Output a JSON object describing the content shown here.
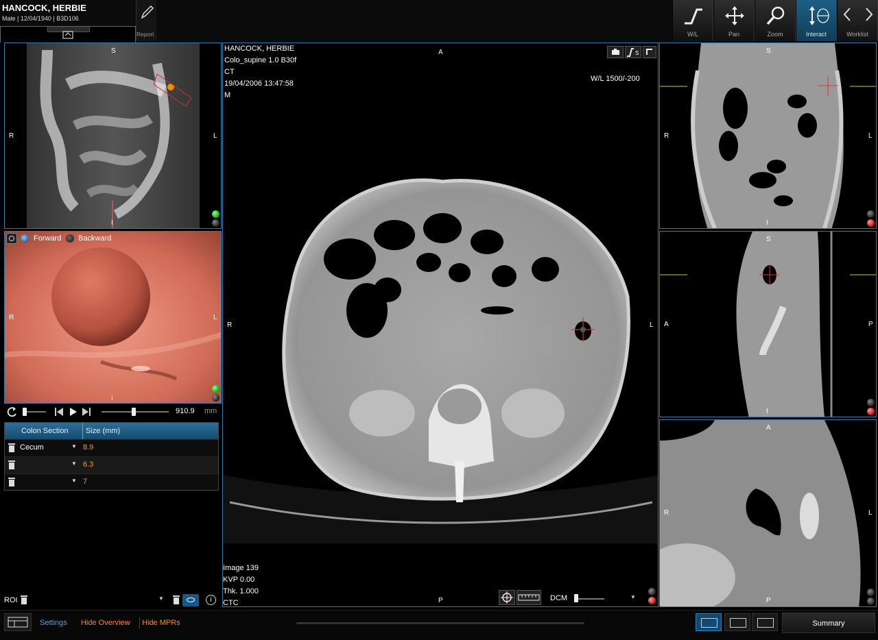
{
  "patient": {
    "name": "HANCOCK, HERBIE",
    "info": "Male | 12/04/1940 | B3D106"
  },
  "toolbar": {
    "report_label": "Report",
    "tools": [
      {
        "label": "W/L",
        "icon": "window-level-icon"
      },
      {
        "label": "Pan",
        "icon": "pan-icon"
      },
      {
        "label": "Zoom",
        "icon": "zoom-icon"
      },
      {
        "label": "Interact",
        "icon": "interact-icon",
        "active": true
      }
    ],
    "worklist_label": "Worklist"
  },
  "overview": {
    "orient_top": "S",
    "orient_left": "R",
    "orient_right": "L",
    "orient_bottom": "I"
  },
  "endo": {
    "forward_label": "Forward",
    "backward_label": "Backward",
    "orient_left": "R",
    "orient_right": "L",
    "orient_bottom": "I",
    "distance": "910.9",
    "unit": "mm"
  },
  "table": {
    "headers": [
      "Colon Section",
      "Size (mm)"
    ],
    "rows": [
      {
        "section": "Cecum",
        "size": "8.9"
      },
      {
        "section": "",
        "size": "6.3"
      },
      {
        "section": "",
        "size": "7"
      }
    ]
  },
  "roi_label": "ROI",
  "axial": {
    "overlay_tl": [
      "HANCOCK, HERBIE",
      "Colo_supine  1.0  B30f",
      "CT",
      "19/04/2006 13:47:58",
      "M"
    ],
    "wl": "W/L  1500/-200",
    "overlay_bl": [
      "Image 139",
      "KVP 0.00",
      "Thk. 1.000",
      "CTC"
    ],
    "orient_top": "A",
    "orient_bottom": "P",
    "orient_left": "R",
    "orient_right": "L",
    "dcm_label": "DCM",
    "snapshot_corner": "S"
  },
  "coronal": {
    "orient_top": "S",
    "orient_left": "R",
    "orient_right": "L",
    "orient_bottom": "I"
  },
  "sagittal": {
    "orient_top": "S",
    "orient_left": "A",
    "orient_right": "P",
    "orient_bottom": "I"
  },
  "zoomview": {
    "orient_top": "A",
    "orient_left": "R",
    "orient_right": "L",
    "orient_bottom": "P"
  },
  "footer": {
    "settings": "Settings",
    "hide_overview": "Hide Overview",
    "hide_mprs": "Hide MPRs",
    "summary": "Summary"
  },
  "colors": {
    "accent": "#3a78a8",
    "orange": "#f08a30",
    "link_blue": "#5aa0d8",
    "endo": "#d06a58"
  }
}
